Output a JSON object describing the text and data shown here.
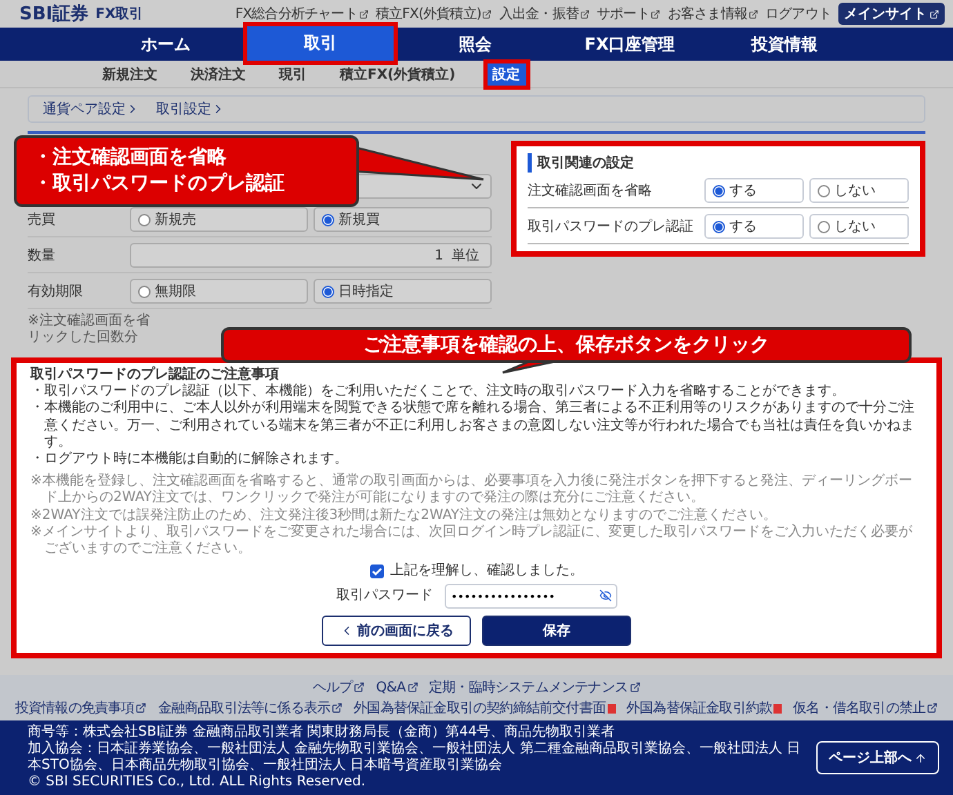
{
  "header": {
    "logo": "SBI証券",
    "product": "FX取引",
    "links": [
      {
        "label": "FX総合分析チャート",
        "external": true
      },
      {
        "label": "積立FX(外貨積立)",
        "external": true
      },
      {
        "label": "入出金・振替",
        "external": true
      },
      {
        "label": "サポート",
        "external": true
      },
      {
        "label": "お客さま情報",
        "external": true
      },
      {
        "label": "ログアウト",
        "external": false
      }
    ],
    "main_site_button": "メインサイト"
  },
  "nav": [
    {
      "label": "ホーム",
      "selected": false,
      "highlighted": false
    },
    {
      "label": "取引",
      "selected": true,
      "highlighted": true
    },
    {
      "label": "照会",
      "selected": false,
      "highlighted": false
    },
    {
      "label": "FX口座管理",
      "selected": false,
      "highlighted": false
    },
    {
      "label": "投資情報",
      "selected": false,
      "highlighted": false
    }
  ],
  "subnav": [
    {
      "label": "新規注文",
      "selected": false,
      "highlighted": false
    },
    {
      "label": "決済注文",
      "selected": false,
      "highlighted": false
    },
    {
      "label": "現引",
      "selected": false,
      "highlighted": false
    },
    {
      "label": "積立FX(外貨積立)",
      "selected": false,
      "highlighted": false
    },
    {
      "label": "設定",
      "selected": true,
      "highlighted": true
    }
  ],
  "breadcrumb": [
    "通貨ペア設定",
    "取引設定"
  ],
  "order_form": {
    "rows": [
      {
        "kind": "select"
      },
      {
        "kind": "radio",
        "label": "売買",
        "options": [
          {
            "label": "新規売",
            "selected": false
          },
          {
            "label": "新規買",
            "selected": true
          }
        ]
      },
      {
        "kind": "quantity",
        "label": "数量",
        "value": "1",
        "unit": "単位"
      },
      {
        "kind": "radio",
        "label": "有効期限",
        "options": [
          {
            "label": "無期限",
            "selected": false
          },
          {
            "label": "日時指定",
            "selected": true
          }
        ]
      }
    ],
    "note": [
      "※注文確認画面を省",
      "リックした回数分"
    ]
  },
  "settings_panel": {
    "title": "取引関連の設定",
    "highlighted": true,
    "rows": [
      {
        "label": "注文確認画面を省略",
        "options": [
          {
            "label": "する",
            "selected": true
          },
          {
            "label": "しない",
            "selected": false
          }
        ]
      },
      {
        "label": "取引パスワードのプレ認証",
        "options": [
          {
            "label": "する",
            "selected": true
          },
          {
            "label": "しない",
            "selected": false
          }
        ]
      }
    ]
  },
  "callouts": [
    {
      "lines": [
        "・注文確認画面を省略",
        "・取引パスワードのプレ認証"
      ]
    },
    {
      "lines": [
        "ご注意事項を確認の上、保存ボタンをクリック"
      ]
    }
  ],
  "notice": {
    "highlighted": true,
    "title": "取引パスワードのプレ認証のご注意事項",
    "bullets": [
      "・取引パスワードのプレ認証（以下、本機能）をご利用いただくことで、注文時の取引パスワード入力を省略することができます。",
      "・本機能のご利用中に、ご本人以外が利用端末を閲覧できる状態で席を離れる場合、第三者による不正利用等のリスクがありますので十分ご注意ください。万一、ご利用されている端末を第三者が不正に利用しお客さまの意図しない注文等が行われた場合でも当社は責任を負いかねます。",
      "・ログアウト時に本機能は自動的に解除されます。"
    ],
    "notes": [
      "※本機能を登録し、注文確認画面を省略すると、通常の取引画面からは、必要事項を入力後に発注ボタンを押下すると発注、ディーリングボード上からの2WAY注文では、ワンクリックで発注が可能になりますので発注の際は充分にご注意ください。",
      "※2WAY注文では誤発注防止のため、注文発注後3秒間は新たな2WAY注文の発注は無効となりますのでご注意ください。",
      "※メインサイトより、取引パスワードをご変更された場合には、次回ログイン時プレ認証に、変更した取引パスワードをご入力いただく必要がございますのでご注意ください。"
    ],
    "agreement": {
      "label": "上記を理解し、確認しました。",
      "checked": true
    },
    "password": {
      "label": "取引パスワード",
      "value": "••••••••••••••••"
    },
    "back_button": "前の画面に戻る",
    "save_button": "保存"
  },
  "footer": {
    "links": [
      [
        {
          "label": "ヘルプ",
          "kind": "external"
        },
        {
          "label": "Q&A",
          "kind": "external"
        },
        {
          "label": "定期・臨時システムメンテナンス",
          "kind": "external"
        }
      ],
      [
        {
          "label": "投資情報の免責事項",
          "kind": "external"
        },
        {
          "label": "金融商品取引法等に係る表示",
          "kind": "external"
        },
        {
          "label": "外国為替保証金取引の契約締結前交付書面",
          "kind": "document"
        },
        {
          "label": "外国為替保証金取引約款",
          "kind": "document"
        },
        {
          "label": "仮名・借名取引の禁止",
          "kind": "external"
        }
      ]
    ],
    "company_lines": [
      "商号等：株式会社SBI証券 金融商品取引業者 関東財務局長（金商）第44号、商品先物取引業者",
      "加入協会：日本証券業協会、一般社団法人 金融先物取引業協会、一般社団法人 第二種金融商品取引業協会、一般社団法人 日本STO協会、日本商品先物取引協会、一般社団法人 日本暗号資産取引業協会"
    ],
    "copyright": "© SBI SECURITIES Co., Ltd. ALL Rights Reserved.",
    "page_top_button": "ページ上部へ"
  }
}
